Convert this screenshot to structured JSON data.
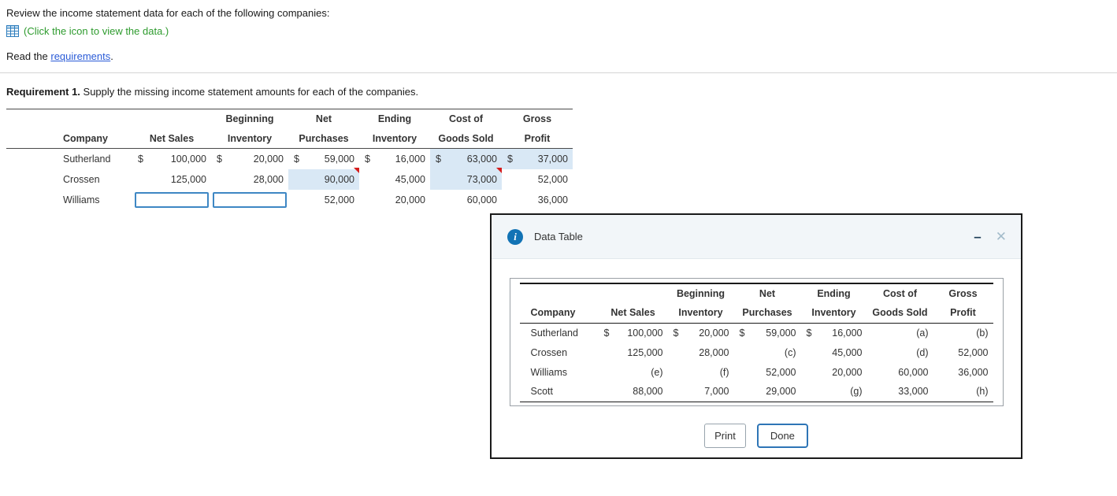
{
  "colors": {
    "caption_green": "#2e9b2e",
    "link_blue": "#2a5bd7",
    "highlight_blue": "#d9e8f5",
    "input_border_blue": "#3e87c4",
    "marker_red": "#d61c1c",
    "dialog_accent_blue": "#2e75b6",
    "info_icon_blue": "#1273b5"
  },
  "currency": "$",
  "icons": {
    "data_table_icon": "spreadsheet-grid",
    "info_icon": "i",
    "minimize_icon": "–",
    "close_icon": "✕",
    "answer_marker_icon": "red-corner-triangle"
  },
  "intro": {
    "line1": "Review the income statement data for each of the following companies:",
    "icon_caption": "(Click the icon to view the data.)",
    "read_prefix": "Read the ",
    "requirements_link": "requirements",
    "period": "."
  },
  "requirement": {
    "label": "Requirement 1.",
    "text": " Supply the missing income statement amounts for each of the companies."
  },
  "headers": {
    "top": {
      "beginning": "Beginning",
      "net": "Net",
      "ending": "Ending",
      "cost_of": "Cost of",
      "gross": "Gross"
    },
    "bottom": {
      "company": "Company",
      "net_sales": "Net Sales",
      "inventory": "Inventory",
      "purchases": "Purchases",
      "goods_sold": "Goods Sold",
      "profit": "Profit"
    }
  },
  "main_table": {
    "rows": [
      {
        "company": "Sutherland",
        "net_sales": "100,000",
        "beg_inv": "20,000",
        "purchases": "59,000",
        "end_inv": "16,000",
        "cogs": "63,000",
        "gross": "37,000"
      },
      {
        "company": "Crossen",
        "net_sales": "125,000",
        "beg_inv": "28,000",
        "purchases": "90,000",
        "end_inv": "45,000",
        "cogs": "73,000",
        "gross": "52,000"
      },
      {
        "company": "Williams",
        "net_sales": "",
        "beg_inv": "",
        "purchases": "52,000",
        "end_inv": "20,000",
        "cogs": "60,000",
        "gross": "36,000"
      }
    ]
  },
  "dialog": {
    "title": "Data Table",
    "print_label": "Print",
    "done_label": "Done",
    "table": {
      "rows": [
        {
          "company": "Sutherland",
          "net_sales": "100,000",
          "beg_inv": "20,000",
          "purchases": "59,000",
          "end_inv": "16,000",
          "cogs": "(a)",
          "gross": "(b)"
        },
        {
          "company": "Crossen",
          "net_sales": "125,000",
          "beg_inv": "28,000",
          "purchases": "(c)",
          "end_inv": "45,000",
          "cogs": "(d)",
          "gross": "52,000"
        },
        {
          "company": "Williams",
          "net_sales": "(e)",
          "beg_inv": "(f)",
          "purchases": "52,000",
          "end_inv": "20,000",
          "cogs": "60,000",
          "gross": "36,000"
        },
        {
          "company": "Scott",
          "net_sales": "88,000",
          "beg_inv": "7,000",
          "purchases": "29,000",
          "end_inv": "(g)",
          "cogs": "33,000",
          "gross": "(h)"
        }
      ]
    }
  }
}
